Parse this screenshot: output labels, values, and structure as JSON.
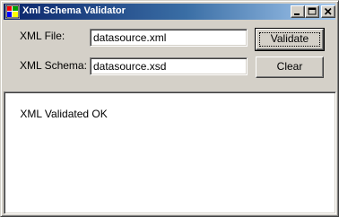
{
  "window": {
    "title": "Xml Schema Validator",
    "icon": "app-window-icon",
    "controls": {
      "minimize": "minimize-icon",
      "maximize": "maximize-icon",
      "close": "close-icon"
    }
  },
  "form": {
    "xml_file_label": "XML File:",
    "xml_file_value": "datasource.xml",
    "xml_schema_label": "XML Schema:",
    "xml_schema_value": "datasource.xsd",
    "validate_label": "Validate",
    "clear_label": "Clear"
  },
  "output": {
    "text": "XML Validated OK"
  },
  "colors": {
    "window_face": "#d4d0c8",
    "title_start": "#0a246a",
    "title_end": "#a6caf0"
  }
}
